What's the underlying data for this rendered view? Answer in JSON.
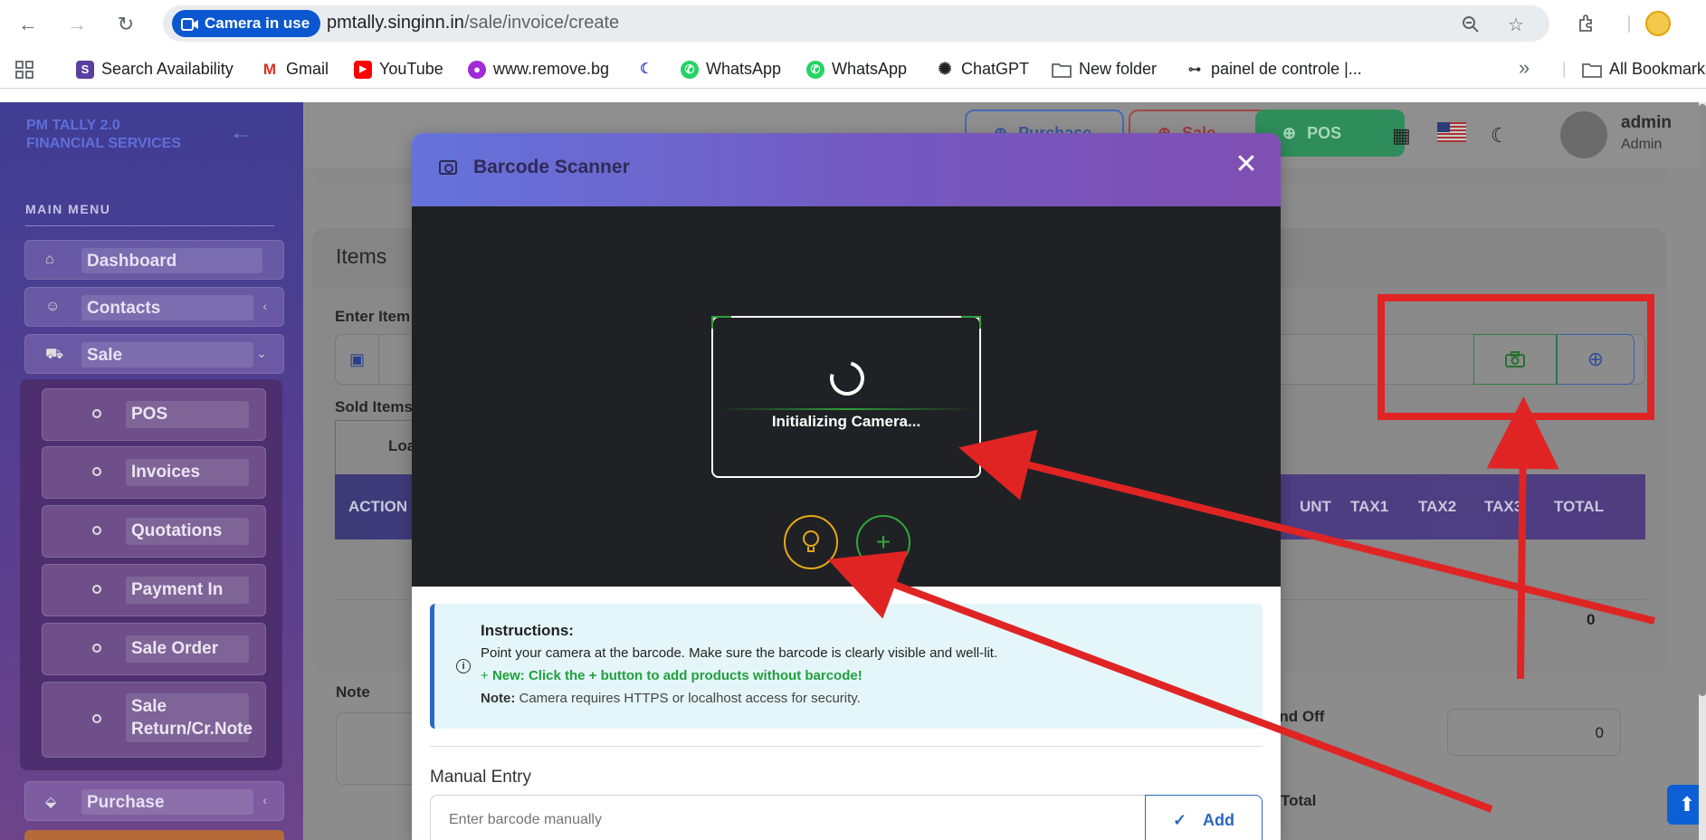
{
  "browser": {
    "camera_pill": "Camera in use",
    "url_host": "pmtally.singinn.in",
    "url_path": "/sale/invoice/create",
    "bookmarks": [
      {
        "label": "Search Availability",
        "color": "#5b3fa0"
      },
      {
        "label": "Gmail",
        "color": "#d93025"
      },
      {
        "label": "YouTube",
        "color": "#ff0000"
      },
      {
        "label": "www.remove.bg",
        "color": "#a12bd8"
      },
      {
        "label": "",
        "color": "#3c55c4"
      },
      {
        "label": "WhatsApp",
        "color": "#25d366"
      },
      {
        "label": "WhatsApp",
        "color": "#25d366"
      },
      {
        "label": "ChatGPT",
        "color": "#222222"
      },
      {
        "label": "New folder",
        "color": "#555555"
      },
      {
        "label": "painel de controle |...",
        "color": "#333333"
      }
    ],
    "more": "»",
    "all_bookmarks": "All Bookmarks"
  },
  "sidebar": {
    "brand_line1": "PM TALLY 2.0",
    "brand_line2": "FINANCIAL SERVICES",
    "menu_title": "MAIN MENU",
    "items": [
      {
        "label": "Dashboard"
      },
      {
        "label": "Contacts"
      },
      {
        "label": "Sale"
      }
    ],
    "sale_submenu": [
      {
        "label": "POS"
      },
      {
        "label": "Invoices"
      },
      {
        "label": "Quotations"
      },
      {
        "label": "Payment In"
      },
      {
        "label": "Sale Order"
      },
      {
        "label": "Sale Return/Cr.Note"
      }
    ],
    "purchase": "Purchase"
  },
  "topbar": {
    "purchase": "Purchase",
    "sale": "Sale",
    "pos": "POS",
    "user_name": "admin",
    "user_role": "Admin"
  },
  "items_card": {
    "title": "Items",
    "enter_label": "Enter Item",
    "sold_label": "Sold Items",
    "load_tab": "Load",
    "columns": [
      "ACTION",
      "UNT",
      "TAX1",
      "TAX2",
      "TAX3",
      "TOTAL"
    ],
    "total_value": "0",
    "note_label": "Note",
    "round_off_label": "und Off",
    "round_off_value": "0",
    "grand_total_label": "Total"
  },
  "modal": {
    "title": "Barcode Scanner",
    "status": "Initializing Camera...",
    "instructions_title": "Instructions:",
    "instructions_line1": "Point your camera at the barcode. Make sure the barcode is clearly visible and well-lit.",
    "instructions_new_prefix": "New:",
    "instructions_new_text": "Click the + button to add products without barcode!",
    "instructions_note_prefix": "Note:",
    "instructions_note_text": "Camera requires HTTPS or localhost access for security.",
    "manual_label": "Manual Entry",
    "manual_placeholder": "Enter barcode manually",
    "add_label": "Add"
  }
}
